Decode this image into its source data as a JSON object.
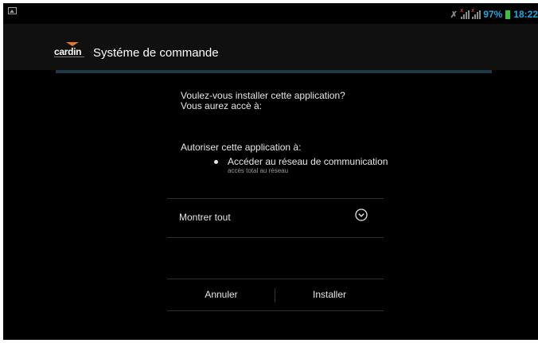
{
  "status_bar": {
    "battery_percent": "97%",
    "time": "18:22",
    "icons": [
      "gallery-icon",
      "mute-icon",
      "signal-no-sim-icon",
      "signal-icon",
      "battery-icon"
    ],
    "accent_color": "#1ea7e1"
  },
  "header": {
    "logo_text": "cardin",
    "title": "Systéme de commande"
  },
  "dialog": {
    "question_line1": "Voulez-vous installer cette application?",
    "question_line2": "Vous aurez accè à:",
    "allow_label": "Autoriser cette application à:",
    "permissions": [
      {
        "title": "Accéder au réseau de communication",
        "description": "accès total au réseau"
      }
    ],
    "show_all_label": "Montrer tout",
    "cancel_label": "Annuler",
    "install_label": "Installer"
  }
}
